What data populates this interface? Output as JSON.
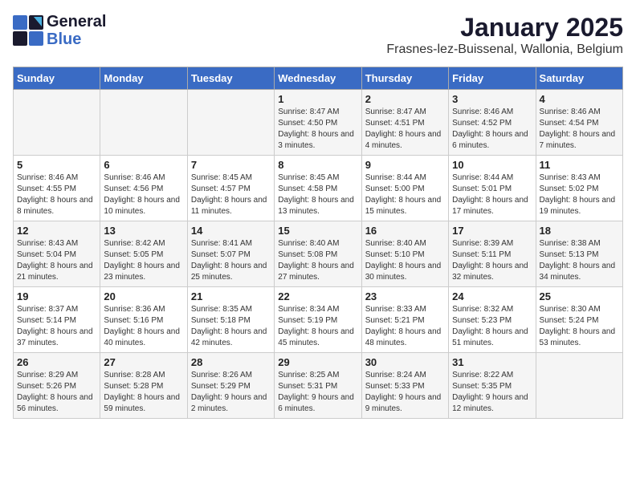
{
  "logo": {
    "general": "General",
    "blue": "Blue"
  },
  "header": {
    "month_year": "January 2025",
    "location": "Frasnes-lez-Buissenal, Wallonia, Belgium"
  },
  "days_of_week": [
    "Sunday",
    "Monday",
    "Tuesday",
    "Wednesday",
    "Thursday",
    "Friday",
    "Saturday"
  ],
  "weeks": [
    [
      {
        "day": "",
        "content": ""
      },
      {
        "day": "",
        "content": ""
      },
      {
        "day": "",
        "content": ""
      },
      {
        "day": "1",
        "content": "Sunrise: 8:47 AM\nSunset: 4:50 PM\nDaylight: 8 hours and 3 minutes."
      },
      {
        "day": "2",
        "content": "Sunrise: 8:47 AM\nSunset: 4:51 PM\nDaylight: 8 hours and 4 minutes."
      },
      {
        "day": "3",
        "content": "Sunrise: 8:46 AM\nSunset: 4:52 PM\nDaylight: 8 hours and 6 minutes."
      },
      {
        "day": "4",
        "content": "Sunrise: 8:46 AM\nSunset: 4:54 PM\nDaylight: 8 hours and 7 minutes."
      }
    ],
    [
      {
        "day": "5",
        "content": "Sunrise: 8:46 AM\nSunset: 4:55 PM\nDaylight: 8 hours and 8 minutes."
      },
      {
        "day": "6",
        "content": "Sunrise: 8:46 AM\nSunset: 4:56 PM\nDaylight: 8 hours and 10 minutes."
      },
      {
        "day": "7",
        "content": "Sunrise: 8:45 AM\nSunset: 4:57 PM\nDaylight: 8 hours and 11 minutes."
      },
      {
        "day": "8",
        "content": "Sunrise: 8:45 AM\nSunset: 4:58 PM\nDaylight: 8 hours and 13 minutes."
      },
      {
        "day": "9",
        "content": "Sunrise: 8:44 AM\nSunset: 5:00 PM\nDaylight: 8 hours and 15 minutes."
      },
      {
        "day": "10",
        "content": "Sunrise: 8:44 AM\nSunset: 5:01 PM\nDaylight: 8 hours and 17 minutes."
      },
      {
        "day": "11",
        "content": "Sunrise: 8:43 AM\nSunset: 5:02 PM\nDaylight: 8 hours and 19 minutes."
      }
    ],
    [
      {
        "day": "12",
        "content": "Sunrise: 8:43 AM\nSunset: 5:04 PM\nDaylight: 8 hours and 21 minutes."
      },
      {
        "day": "13",
        "content": "Sunrise: 8:42 AM\nSunset: 5:05 PM\nDaylight: 8 hours and 23 minutes."
      },
      {
        "day": "14",
        "content": "Sunrise: 8:41 AM\nSunset: 5:07 PM\nDaylight: 8 hours and 25 minutes."
      },
      {
        "day": "15",
        "content": "Sunrise: 8:40 AM\nSunset: 5:08 PM\nDaylight: 8 hours and 27 minutes."
      },
      {
        "day": "16",
        "content": "Sunrise: 8:40 AM\nSunset: 5:10 PM\nDaylight: 8 hours and 30 minutes."
      },
      {
        "day": "17",
        "content": "Sunrise: 8:39 AM\nSunset: 5:11 PM\nDaylight: 8 hours and 32 minutes."
      },
      {
        "day": "18",
        "content": "Sunrise: 8:38 AM\nSunset: 5:13 PM\nDaylight: 8 hours and 34 minutes."
      }
    ],
    [
      {
        "day": "19",
        "content": "Sunrise: 8:37 AM\nSunset: 5:14 PM\nDaylight: 8 hours and 37 minutes."
      },
      {
        "day": "20",
        "content": "Sunrise: 8:36 AM\nSunset: 5:16 PM\nDaylight: 8 hours and 40 minutes."
      },
      {
        "day": "21",
        "content": "Sunrise: 8:35 AM\nSunset: 5:18 PM\nDaylight: 8 hours and 42 minutes."
      },
      {
        "day": "22",
        "content": "Sunrise: 8:34 AM\nSunset: 5:19 PM\nDaylight: 8 hours and 45 minutes."
      },
      {
        "day": "23",
        "content": "Sunrise: 8:33 AM\nSunset: 5:21 PM\nDaylight: 8 hours and 48 minutes."
      },
      {
        "day": "24",
        "content": "Sunrise: 8:32 AM\nSunset: 5:23 PM\nDaylight: 8 hours and 51 minutes."
      },
      {
        "day": "25",
        "content": "Sunrise: 8:30 AM\nSunset: 5:24 PM\nDaylight: 8 hours and 53 minutes."
      }
    ],
    [
      {
        "day": "26",
        "content": "Sunrise: 8:29 AM\nSunset: 5:26 PM\nDaylight: 8 hours and 56 minutes."
      },
      {
        "day": "27",
        "content": "Sunrise: 8:28 AM\nSunset: 5:28 PM\nDaylight: 8 hours and 59 minutes."
      },
      {
        "day": "28",
        "content": "Sunrise: 8:26 AM\nSunset: 5:29 PM\nDaylight: 9 hours and 2 minutes."
      },
      {
        "day": "29",
        "content": "Sunrise: 8:25 AM\nSunset: 5:31 PM\nDaylight: 9 hours and 6 minutes."
      },
      {
        "day": "30",
        "content": "Sunrise: 8:24 AM\nSunset: 5:33 PM\nDaylight: 9 hours and 9 minutes."
      },
      {
        "day": "31",
        "content": "Sunrise: 8:22 AM\nSunset: 5:35 PM\nDaylight: 9 hours and 12 minutes."
      },
      {
        "day": "",
        "content": ""
      }
    ]
  ]
}
